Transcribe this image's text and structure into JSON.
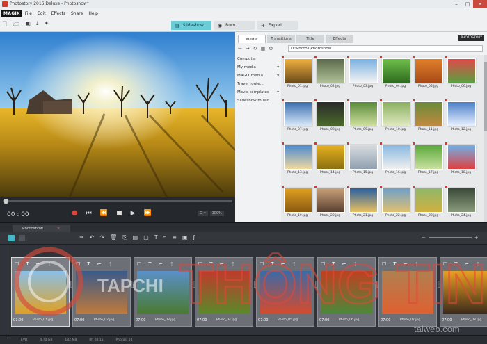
{
  "window": {
    "title": "Photostory 2016 Deluxe - Photoshow*",
    "minimize_glyph": "–",
    "maximize_glyph": "□",
    "close_glyph": "✕"
  },
  "menu": {
    "logo": "MAGIX",
    "items": [
      "File",
      "Edit",
      "Effects",
      "Share",
      "Help"
    ]
  },
  "toolbar": {
    "icons": [
      "new-file-icon",
      "open-folder-icon",
      "save-icon",
      "export-icon",
      "effects-icon"
    ]
  },
  "modes": [
    {
      "label": "Slideshow",
      "icon": "slideshow-icon",
      "active": true
    },
    {
      "label": "Burn",
      "icon": "disc-icon",
      "active": false
    },
    {
      "label": "Export",
      "icon": "export-icon",
      "active": false
    }
  ],
  "preview": {
    "timecode": "00 : 00",
    "zoom_label": "100%"
  },
  "media_panel": {
    "tabs": [
      "Media",
      "Transitions",
      "Title",
      "Effects"
    ],
    "active_tab": "Media",
    "badge": "PHOTOSTORY",
    "path": "D:\\Photos\\Photoshow",
    "tree": [
      "Computer",
      "My media",
      "MAGIX media",
      "Travel route...",
      "Movie templates",
      "Slideshow music"
    ],
    "photos": [
      "Photo_01.jpg",
      "Photo_02.jpg",
      "Photo_03.jpg",
      "Photo_04.jpg",
      "Photo_05.jpg",
      "Photo_06.jpg",
      "Photo_07.jpg",
      "Photo_08.jpg",
      "Photo_09.jpg",
      "Photo_10.jpg",
      "Photo_11.jpg",
      "Photo_12.jpg",
      "Photo_13.jpg",
      "Photo_14.jpg",
      "Photo_15.jpg",
      "Photo_16.jpg",
      "Photo_17.jpg",
      "Photo_18.jpg",
      "Photo_19.jpg",
      "Photo_20.jpg",
      "Photo_21.jpg",
      "Photo_22.jpg",
      "Photo_23.jpg",
      "Photo_24.jpg"
    ]
  },
  "storyboard": {
    "tab_label": "Photoshow",
    "close_glyph": "×",
    "clips": [
      {
        "time": "07:00",
        "name": "Photo_01.jpg"
      },
      {
        "time": "07:00",
        "name": "Photo_02.jpg"
      },
      {
        "time": "07:00",
        "name": "Photo_03.jpg"
      },
      {
        "time": "07:00",
        "name": "Photo_04.jpg"
      },
      {
        "time": "07:00",
        "name": "Photo_05.jpg"
      },
      {
        "time": "07:00",
        "name": "Photo_06.jpg"
      },
      {
        "time": "07:00",
        "name": "Photo_07.jpg"
      },
      {
        "time": "07:00",
        "name": "Photo_08.jpg"
      }
    ]
  },
  "status": [
    "EVD",
    "4.70 GB",
    "182 MB",
    "0h 08:15",
    "Photos: 24"
  ],
  "watermark": {
    "brand": "TAPCHI",
    "word": "THÔNG TIN",
    "site": "taiweb.com"
  },
  "colors": {
    "accent": "#6bcbd6",
    "rec": "#e0443a",
    "panel": "#f1f2f3",
    "dark": "#30343a"
  }
}
